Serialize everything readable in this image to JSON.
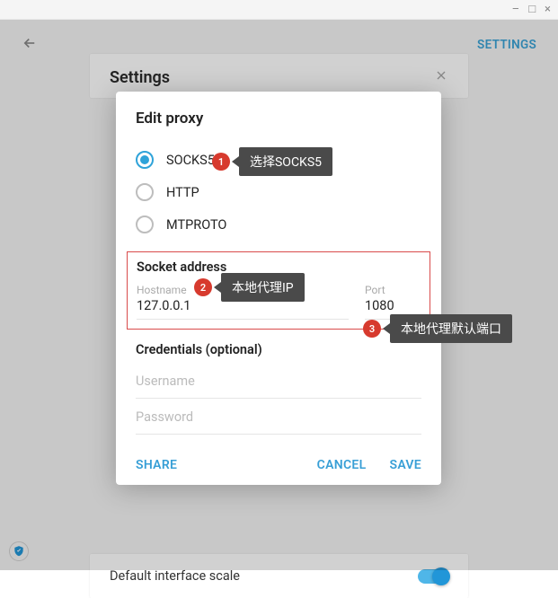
{
  "window": {
    "min": "–",
    "max": "□",
    "close": "×"
  },
  "topbar": {
    "settings_link": "SETTINGS"
  },
  "settings": {
    "title": "Settings",
    "scale_label": "Default interface scale",
    "scale_on": true
  },
  "modal": {
    "title": "Edit proxy",
    "radios": {
      "socks5": "SOCKS5",
      "http": "HTTP",
      "mtproto": "MTPROTO",
      "selected": "socks5"
    },
    "socket": {
      "title": "Socket address",
      "hostname_label": "Hostname",
      "hostname_value": "127.0.0.1",
      "port_label": "Port",
      "port_value": "1080"
    },
    "creds": {
      "title": "Credentials (optional)",
      "username_ph": "Username",
      "password_ph": "Password"
    },
    "footer": {
      "share": "SHARE",
      "cancel": "CANCEL",
      "save": "SAVE"
    }
  },
  "callouts": {
    "c1": {
      "num": "1",
      "text": "选择SOCKS5"
    },
    "c2": {
      "num": "2",
      "text": "本地代理IP"
    },
    "c3": {
      "num": "3",
      "text": "本地代理默认端口"
    }
  }
}
